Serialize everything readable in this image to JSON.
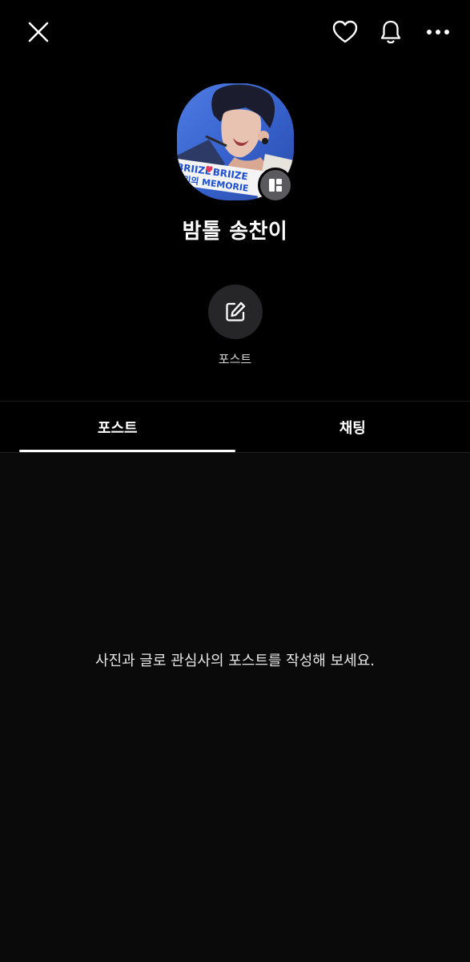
{
  "top_bar": {
    "close_icon": "close-icon",
    "heart_icon": "heart-icon",
    "bell_icon": "bell-icon",
    "more_icon": "more-horizontal-icon"
  },
  "profile": {
    "name": "밤톨 송찬이",
    "avatar_badge_icon": "layout-widget-icon",
    "avatar_banner_text_1": "BRIIZE",
    "avatar_banner_text_2": "BRIIZE",
    "avatar_banner_text_3": "우리의 MEMORIE"
  },
  "post_action": {
    "icon": "edit-icon",
    "label": "포스트"
  },
  "tabs": [
    {
      "label": "포스트",
      "active": true
    },
    {
      "label": "채팅",
      "active": false
    }
  ],
  "content": {
    "empty_message": "사진과 글로 관심사의 포스트를 작성해 보세요."
  },
  "colors": {
    "background": "#000000",
    "content_background": "#0a0a0b",
    "action_button": "#262628",
    "badge": "#5a5a5e",
    "text": "#ffffff"
  }
}
